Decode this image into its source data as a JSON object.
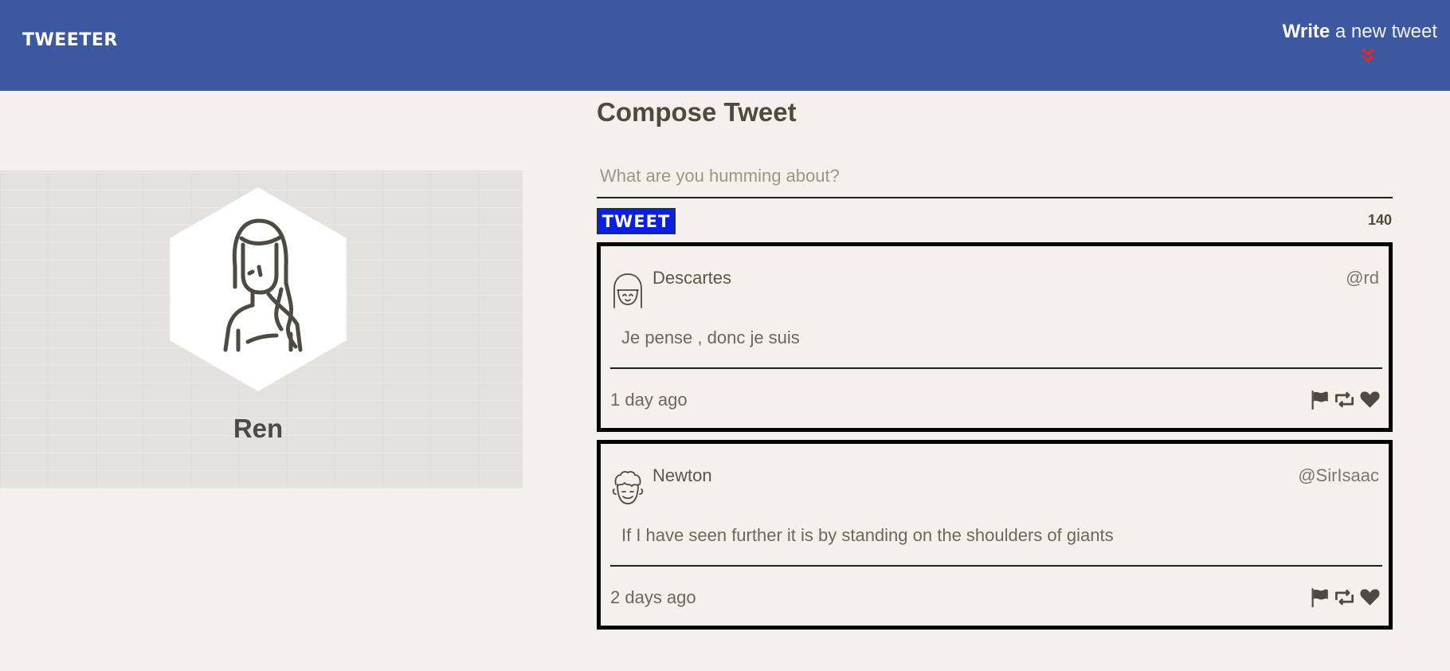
{
  "nav": {
    "brand": "TWEETER",
    "compose_strong": "Write",
    "compose_light": " a new tweet",
    "chevron_icon": "double-chevron-down-icon",
    "chevron_color": "#e8262a",
    "background": "#3b58a0"
  },
  "profile": {
    "name": "Ren",
    "avatar_icon": "girl-avatar-icon"
  },
  "compose": {
    "title": "Compose Tweet",
    "placeholder": "What are you humming about?",
    "button_label": "TWEET",
    "counter": "140",
    "button_color": "#0a1ee8"
  },
  "tweets": [
    {
      "name": "Descartes",
      "handle": "@rd",
      "content": "Je pense , donc je suis",
      "time": "1 day ago",
      "avatar_icon": "bob-hair-avatar-icon"
    },
    {
      "name": "Newton",
      "handle": "@SirIsaac",
      "content": "If I have seen further it is by standing on the shoulders of giants",
      "time": "2 days ago",
      "avatar_icon": "curly-hair-avatar-icon"
    }
  ],
  "actions": [
    "flag-icon",
    "retweet-icon",
    "heart-icon"
  ]
}
